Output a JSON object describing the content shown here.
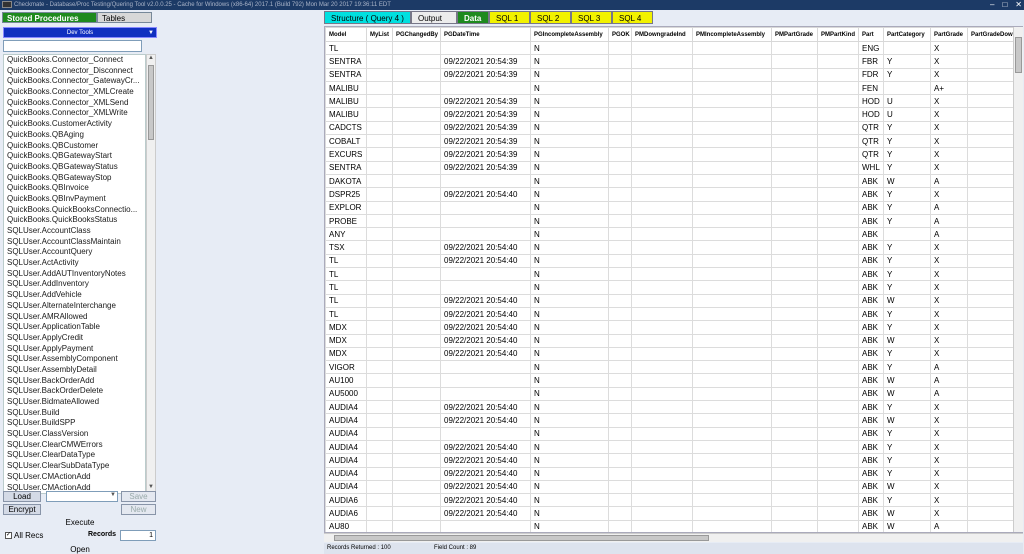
{
  "window": {
    "title": "Checkmate - Database/Proc Testing/Quering Tool v2.0.0.25 - Cache for Windows (x86-64) 2017.1 (Build 792) Mon Mar 20 2017 19:36:11 EDT",
    "minimize": "–",
    "maximize": "□",
    "close": "✕"
  },
  "left": {
    "tabs": [
      "Stored Procedures",
      "Tables"
    ],
    "dropdown": "Dev Tools",
    "procedures": [
      "QuickBooks.Connector_Connect",
      "QuickBooks.Connector_Disconnect",
      "QuickBooks.Connector_GatewayCr...",
      "QuickBooks.Connector_XMLCreate",
      "QuickBooks.Connector_XMLSend",
      "QuickBooks.Connector_XMLWrite",
      "QuickBooks.CustomerActivity",
      "QuickBooks.QBAging",
      "QuickBooks.QBCustomer",
      "QuickBooks.QBGatewayStart",
      "QuickBooks.QBGatewayStatus",
      "QuickBooks.QBGatewayStop",
      "QuickBooks.QBInvoice",
      "QuickBooks.QBInvPayment",
      "QuickBooks.QuickBooksConnectio...",
      "QuickBooks.QuickBooksStatus",
      "SQLUser.AccountClass",
      "SQLUser.AccountClassMaintain",
      "SQLUser.AccountQuery",
      "SQLUser.ActActivity",
      "SQLUser.AddAUTInventoryNotes",
      "SQLUser.AddInventory",
      "SQLUser.AddVehicle",
      "SQLUser.AlternateInterchange",
      "SQLUser.AMRAllowed",
      "SQLUser.ApplicationTable",
      "SQLUser.ApplyCredit",
      "SQLUser.ApplyPayment",
      "SQLUser.AssemblyComponent",
      "SQLUser.AssemblyDetail",
      "SQLUser.BackOrderAdd",
      "SQLUser.BackOrderDelete",
      "SQLUser.BidmateAllowed",
      "SQLUser.Build",
      "SQLUser.BuildSPP",
      "SQLUser.ClassVersion",
      "SQLUser.ClearCMWErrors",
      "SQLUser.ClearDataType",
      "SQLUser.ClearSubDataType",
      "SQLUser.CMActionAdd",
      "SQLUser.CMActionAdd"
    ],
    "load": "Load",
    "encrypt": "Encrypt",
    "save": "Save",
    "new": "New",
    "execute": "Execute",
    "all_recs": "All Recs",
    "records_label": "Records",
    "records_value": "1",
    "open": "Open"
  },
  "tabs": {
    "structure": "Structure ( Query 4 )",
    "output": "Output",
    "data": "Data",
    "sql": [
      "SQL 1",
      "SQL 2",
      "SQL 3",
      "SQL 4"
    ]
  },
  "grid": {
    "columns": [
      "Model",
      "MyList",
      "PGChangedBy",
      "PGDateTime",
      "PGIncompleteAssembly",
      "PGOK",
      "PMDowngradeInd",
      "PMIncompleteAssembly",
      "PMPartGrade",
      "PMPartKind",
      "Part",
      "PartCategory",
      "PartGrade",
      "PartGradeDow"
    ],
    "rows": [
      [
        "TL",
        "",
        "",
        "",
        "N",
        "",
        "",
        "",
        "",
        "",
        "ENG",
        "",
        "X",
        ""
      ],
      [
        "SENTRA",
        "",
        "",
        "09/22/2021 20:54:39",
        "N",
        "",
        "",
        "",
        "",
        "",
        "FBR",
        "Y",
        "X",
        ""
      ],
      [
        "SENTRA",
        "",
        "",
        "09/22/2021 20:54:39",
        "N",
        "",
        "",
        "",
        "",
        "",
        "FDR",
        "Y",
        "X",
        ""
      ],
      [
        "MALIBU",
        "",
        "",
        "",
        "N",
        "",
        "",
        "",
        "",
        "",
        "FEN",
        "",
        "A+",
        ""
      ],
      [
        "MALIBU",
        "",
        "",
        "09/22/2021 20:54:39",
        "N",
        "",
        "",
        "",
        "",
        "",
        "HOD",
        "U",
        "X",
        ""
      ],
      [
        "MALIBU",
        "",
        "",
        "09/22/2021 20:54:39",
        "N",
        "",
        "",
        "",
        "",
        "",
        "HOD",
        "U",
        "X",
        ""
      ],
      [
        "CADCTS",
        "",
        "",
        "09/22/2021 20:54:39",
        "N",
        "",
        "",
        "",
        "",
        "",
        "QTR",
        "Y",
        "X",
        ""
      ],
      [
        "COBALT",
        "",
        "",
        "09/22/2021 20:54:39",
        "N",
        "",
        "",
        "",
        "",
        "",
        "QTR",
        "Y",
        "X",
        ""
      ],
      [
        "EXCURS",
        "",
        "",
        "09/22/2021 20:54:39",
        "N",
        "",
        "",
        "",
        "",
        "",
        "QTR",
        "Y",
        "X",
        ""
      ],
      [
        "SENTRA",
        "",
        "",
        "09/22/2021 20:54:39",
        "N",
        "",
        "",
        "",
        "",
        "",
        "WHL",
        "Y",
        "X",
        ""
      ],
      [
        "DAKOTA",
        "",
        "",
        "",
        "N",
        "",
        "",
        "",
        "",
        "",
        "ABK",
        "W",
        "A",
        ""
      ],
      [
        "DSPR25",
        "",
        "",
        "09/22/2021 20:54:40",
        "N",
        "",
        "",
        "",
        "",
        "",
        "ABK",
        "Y",
        "X",
        ""
      ],
      [
        "EXPLOR",
        "",
        "",
        "",
        "N",
        "",
        "",
        "",
        "",
        "",
        "ABK",
        "Y",
        "A",
        ""
      ],
      [
        "PROBE",
        "",
        "",
        "",
        "N",
        "",
        "",
        "",
        "",
        "",
        "ABK",
        "Y",
        "A",
        ""
      ],
      [
        "ANY",
        "",
        "",
        "",
        "N",
        "",
        "",
        "",
        "",
        "",
        "ABK",
        "",
        "A",
        ""
      ],
      [
        "TSX",
        "",
        "",
        "09/22/2021 20:54:40",
        "N",
        "",
        "",
        "",
        "",
        "",
        "ABK",
        "Y",
        "X",
        ""
      ],
      [
        "TL",
        "",
        "",
        "09/22/2021 20:54:40",
        "N",
        "",
        "",
        "",
        "",
        "",
        "ABK",
        "Y",
        "X",
        ""
      ],
      [
        "TL",
        "",
        "",
        "",
        "N",
        "",
        "",
        "",
        "",
        "",
        "ABK",
        "Y",
        "X",
        ""
      ],
      [
        "TL",
        "",
        "",
        "",
        "N",
        "",
        "",
        "",
        "",
        "",
        "ABK",
        "Y",
        "X",
        ""
      ],
      [
        "TL",
        "",
        "",
        "09/22/2021 20:54:40",
        "N",
        "",
        "",
        "",
        "",
        "",
        "ABK",
        "W",
        "X",
        ""
      ],
      [
        "TL",
        "",
        "",
        "09/22/2021 20:54:40",
        "N",
        "",
        "",
        "",
        "",
        "",
        "ABK",
        "Y",
        "X",
        ""
      ],
      [
        "MDX",
        "",
        "",
        "09/22/2021 20:54:40",
        "N",
        "",
        "",
        "",
        "",
        "",
        "ABK",
        "Y",
        "X",
        ""
      ],
      [
        "MDX",
        "",
        "",
        "09/22/2021 20:54:40",
        "N",
        "",
        "",
        "",
        "",
        "",
        "ABK",
        "W",
        "X",
        ""
      ],
      [
        "MDX",
        "",
        "",
        "09/22/2021 20:54:40",
        "N",
        "",
        "",
        "",
        "",
        "",
        "ABK",
        "Y",
        "X",
        ""
      ],
      [
        "VIGOR",
        "",
        "",
        "",
        "N",
        "",
        "",
        "",
        "",
        "",
        "ABK",
        "Y",
        "A",
        ""
      ],
      [
        "AU100",
        "",
        "",
        "",
        "N",
        "",
        "",
        "",
        "",
        "",
        "ABK",
        "W",
        "A",
        ""
      ],
      [
        "AU5000",
        "",
        "",
        "",
        "N",
        "",
        "",
        "",
        "",
        "",
        "ABK",
        "W",
        "A",
        ""
      ],
      [
        "AUDIA4",
        "",
        "",
        "09/22/2021 20:54:40",
        "N",
        "",
        "",
        "",
        "",
        "",
        "ABK",
        "Y",
        "X",
        ""
      ],
      [
        "AUDIA4",
        "",
        "",
        "09/22/2021 20:54:40",
        "N",
        "",
        "",
        "",
        "",
        "",
        "ABK",
        "W",
        "X",
        ""
      ],
      [
        "AUDIA4",
        "",
        "",
        "",
        "N",
        "",
        "",
        "",
        "",
        "",
        "ABK",
        "Y",
        "X",
        ""
      ],
      [
        "AUDIA4",
        "",
        "",
        "09/22/2021 20:54:40",
        "N",
        "",
        "",
        "",
        "",
        "",
        "ABK",
        "Y",
        "X",
        ""
      ],
      [
        "AUDIA4",
        "",
        "",
        "09/22/2021 20:54:40",
        "N",
        "",
        "",
        "",
        "",
        "",
        "ABK",
        "Y",
        "X",
        ""
      ],
      [
        "AUDIA4",
        "",
        "",
        "09/22/2021 20:54:40",
        "N",
        "",
        "",
        "",
        "",
        "",
        "ABK",
        "Y",
        "X",
        ""
      ],
      [
        "AUDIA4",
        "",
        "",
        "09/22/2021 20:54:40",
        "N",
        "",
        "",
        "",
        "",
        "",
        "ABK",
        "W",
        "X",
        ""
      ],
      [
        "AUDIA6",
        "",
        "",
        "09/22/2021 20:54:40",
        "N",
        "",
        "",
        "",
        "",
        "",
        "ABK",
        "Y",
        "X",
        ""
      ],
      [
        "AUDIA6",
        "",
        "",
        "09/22/2021 20:54:40",
        "N",
        "",
        "",
        "",
        "",
        "",
        "ABK",
        "W",
        "X",
        ""
      ],
      [
        "AU80",
        "",
        "",
        "",
        "N",
        "",
        "",
        "",
        "",
        "",
        "ABK",
        "W",
        "A",
        ""
      ]
    ]
  },
  "status": {
    "returned": "Records Returned : 100",
    "fields": "Field Count : 89"
  },
  "colors": {
    "active_tab": "#1e8a1e",
    "structure_tab": "#00e0e0",
    "sql_tab": "#f2f200",
    "dropdown": "#1030c0",
    "titlebar": "#1c3a66"
  }
}
